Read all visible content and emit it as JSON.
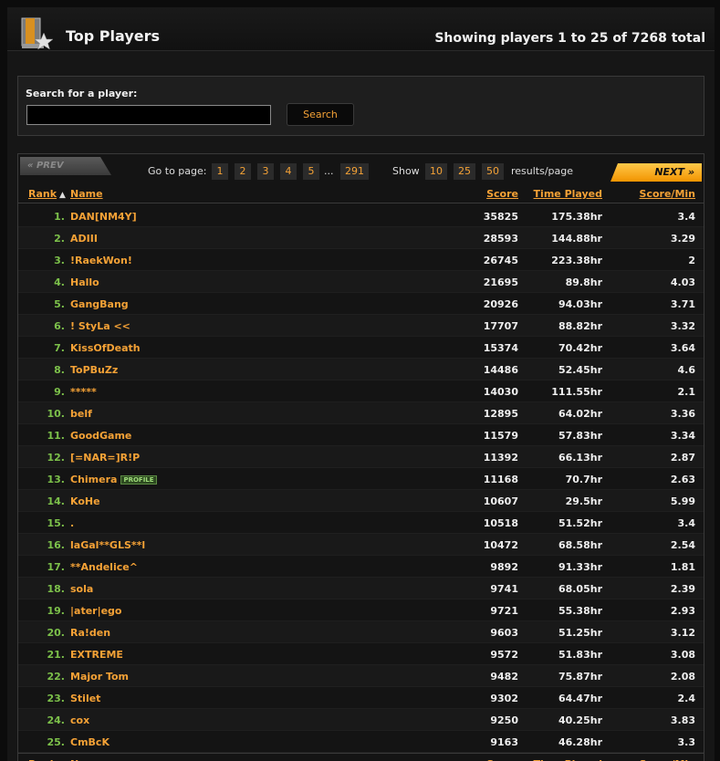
{
  "header": {
    "title": "Top Players",
    "showing": "Showing players 1 to 25 of 7268 total"
  },
  "search": {
    "label": "Search for a player:",
    "value": "",
    "button": "Search"
  },
  "pager": {
    "prev": "« PREV",
    "next": "NEXT »",
    "goto_label": "Go to page:",
    "pages": [
      "1",
      "2",
      "3",
      "4",
      "5"
    ],
    "ellipsis": "...",
    "last_page": "291",
    "show_label": "Show",
    "page_sizes": [
      "10",
      "25",
      "50"
    ],
    "results_label": "results/page"
  },
  "columns": {
    "rank": "Rank",
    "name": "Name",
    "score": "Score",
    "time": "Time Played",
    "spm": "Score/Min"
  },
  "rows": [
    {
      "rank": "1.",
      "name": "DAN[NM4Y]",
      "score": "35825",
      "time": "175.38hr",
      "spm": "3.4"
    },
    {
      "rank": "2.",
      "name": "ADIII",
      "score": "28593",
      "time": "144.88hr",
      "spm": "3.29"
    },
    {
      "rank": "3.",
      "name": "!RaekWon!",
      "score": "26745",
      "time": "223.38hr",
      "spm": "2"
    },
    {
      "rank": "4.",
      "name": "Hallo",
      "score": "21695",
      "time": "89.8hr",
      "spm": "4.03"
    },
    {
      "rank": "5.",
      "name": "GangBang",
      "score": "20926",
      "time": "94.03hr",
      "spm": "3.71"
    },
    {
      "rank": "6.",
      "name": "! StyLa <<",
      "score": "17707",
      "time": "88.82hr",
      "spm": "3.32"
    },
    {
      "rank": "7.",
      "name": "KissOfDeath",
      "score": "15374",
      "time": "70.42hr",
      "spm": "3.64"
    },
    {
      "rank": "8.",
      "name": "ToPBuZz",
      "score": "14486",
      "time": "52.45hr",
      "spm": "4.6"
    },
    {
      "rank": "9.",
      "name": "*****",
      "score": "14030",
      "time": "111.55hr",
      "spm": "2.1"
    },
    {
      "rank": "10.",
      "name": "belf",
      "score": "12895",
      "time": "64.02hr",
      "spm": "3.36"
    },
    {
      "rank": "11.",
      "name": "GoodGame",
      "score": "11579",
      "time": "57.83hr",
      "spm": "3.34"
    },
    {
      "rank": "12.",
      "name": "[=NAR=]R!P",
      "score": "11392",
      "time": "66.13hr",
      "spm": "2.87"
    },
    {
      "rank": "13.",
      "name": "Chimera",
      "badge": "PROFILE",
      "score": "11168",
      "time": "70.7hr",
      "spm": "2.63"
    },
    {
      "rank": "14.",
      "name": "KoHe",
      "score": "10607",
      "time": "29.5hr",
      "spm": "5.99"
    },
    {
      "rank": "15.",
      "name": ".",
      "score": "10518",
      "time": "51.52hr",
      "spm": "3.4"
    },
    {
      "rank": "16.",
      "name": "laGal**GLS**l",
      "score": "10472",
      "time": "68.58hr",
      "spm": "2.54"
    },
    {
      "rank": "17.",
      "name": "**Andelice^",
      "score": "9892",
      "time": "91.33hr",
      "spm": "1.81"
    },
    {
      "rank": "18.",
      "name": "sola",
      "score": "9741",
      "time": "68.05hr",
      "spm": "2.39"
    },
    {
      "rank": "19.",
      "name": "|ater|ego",
      "score": "9721",
      "time": "55.38hr",
      "spm": "2.93"
    },
    {
      "rank": "20.",
      "name": "Ra!den",
      "score": "9603",
      "time": "51.25hr",
      "spm": "3.12"
    },
    {
      "rank": "21.",
      "name": "EXTREME",
      "score": "9572",
      "time": "51.83hr",
      "spm": "3.08"
    },
    {
      "rank": "22.",
      "name": "Major Tom",
      "score": "9482",
      "time": "75.87hr",
      "spm": "2.08"
    },
    {
      "rank": "23.",
      "name": "Stilet",
      "score": "9302",
      "time": "64.47hr",
      "spm": "2.4"
    },
    {
      "rank": "24.",
      "name": "cox",
      "score": "9250",
      "time": "40.25hr",
      "spm": "3.83"
    },
    {
      "rank": "25.",
      "name": "CmBcK",
      "score": "9163",
      "time": "46.28hr",
      "spm": "3.3"
    }
  ],
  "icons": {
    "trophy": "trophy-star-icon",
    "sort": "sort-ascending-icon"
  },
  "colors": {
    "accent": "#f5a236",
    "rank": "#7cc04a",
    "background": "#161616"
  }
}
